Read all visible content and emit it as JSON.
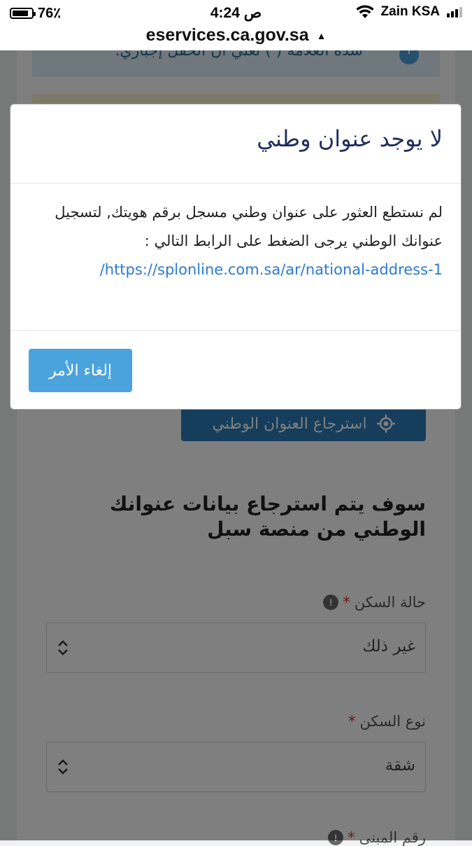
{
  "status_bar": {
    "battery": "76٪",
    "time": "4:24 ص",
    "carrier": "Zain KSA",
    "battery_icon": "battery-icon",
    "wifi_icon": "wifi-icon",
    "signal_icon": "signal-icon"
  },
  "browser": {
    "url": "eservices.ca.gov.sa",
    "warning_icon": "warning-icon"
  },
  "page": {
    "info_text": "شدة العلامة ( ) تعني أن الحقل إجباري.",
    "retrieve_button": "استرجاع العنوان الوطني",
    "retrieve_icon": "location-target-icon",
    "section_title": "سوف يتم استرجاع بيانات عنوانك الوطني من منصة سبل",
    "fields": [
      {
        "label": "حالة السكن",
        "required_mark": "*",
        "value": "غير ذلك",
        "help_icon": "help-icon"
      },
      {
        "label": "نوع السكن",
        "required_mark": "*",
        "value": "شقة"
      },
      {
        "label": "رقم المبنى",
        "required_mark": "*",
        "help_icon": "help-icon"
      }
    ]
  },
  "modal": {
    "title": "لا يوجد عنوان وطني",
    "body_text": "لم نستطع العثور على عنوان وطني مسجل برقم هويتك, لتسجيل عنوانك الوطني يرجى الضغط على الرابط التالي :",
    "link": "https://splonline.com.sa/ar/national-address-1/",
    "cancel_button": "إلغاء الأمر"
  },
  "colors": {
    "modal_title": "#1f2d5c",
    "link": "#2a7ad6",
    "cancel_button_bg": "#4aa3dc",
    "retrieve_button_bg": "#2c7db8",
    "required": "#d0312d"
  }
}
